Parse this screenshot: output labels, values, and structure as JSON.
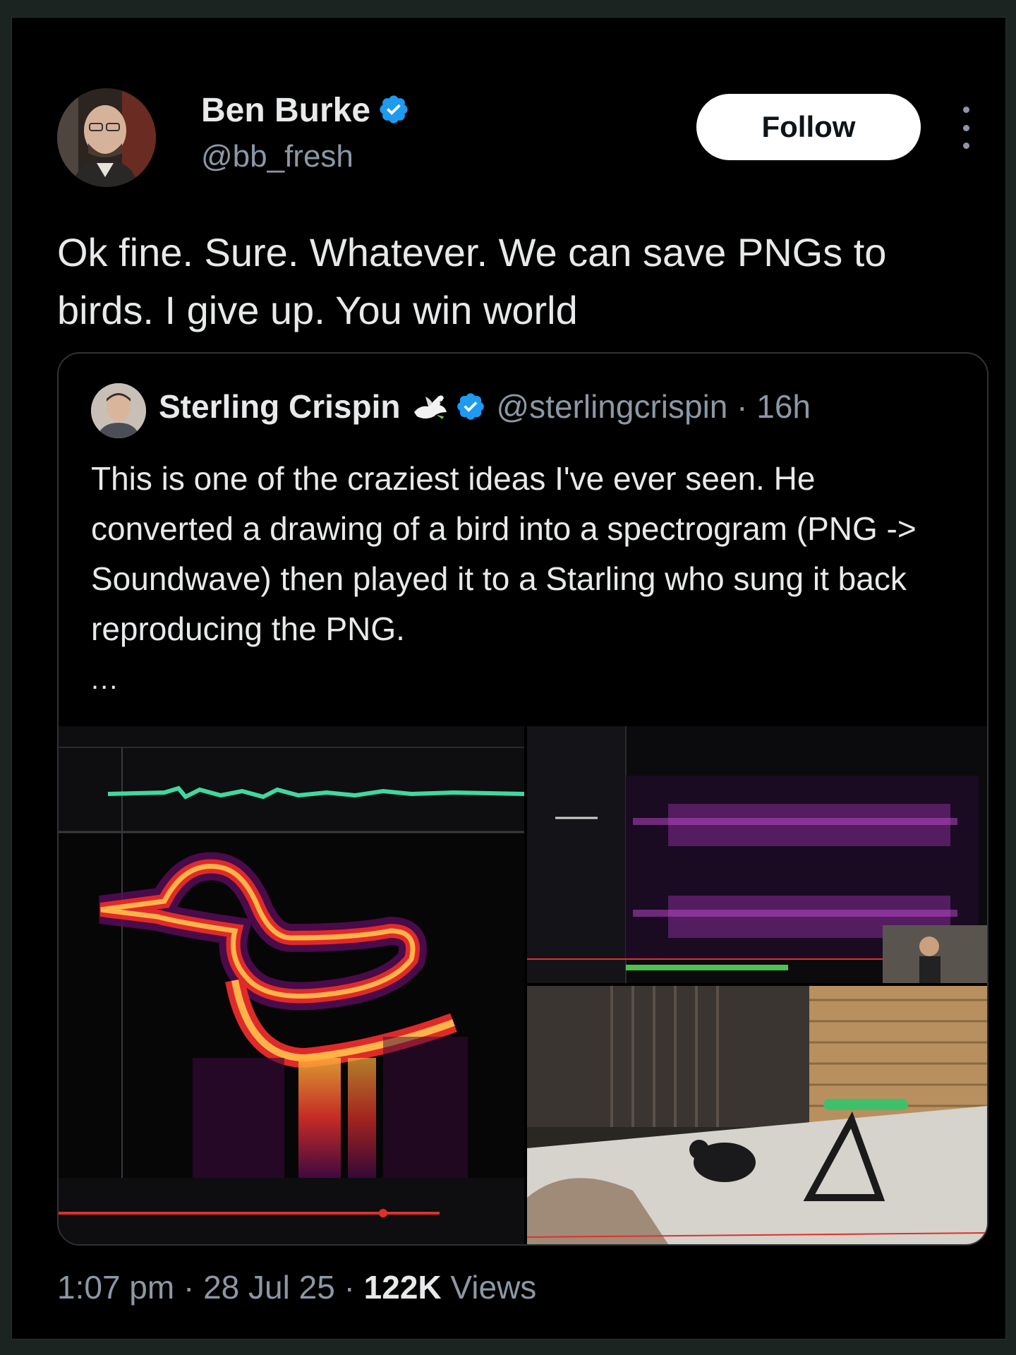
{
  "tweet": {
    "author": {
      "name": "Ben Burke",
      "handle": "@bb_fresh",
      "verified": true
    },
    "follow_label": "Follow",
    "text": "Ok fine. Sure. Whatever. We can save PNGs to birds. I give up. You win world",
    "timestamp": "1:07 pm · 28 Jul 25 · ",
    "views_count": "122K",
    "views_label": " Views"
  },
  "quote": {
    "name": "Sterling Crispin",
    "handle": "@sterlingcrispin · 16h",
    "verified": true,
    "text": "This is one of the craziest ideas I've ever seen. He converted a drawing of a bird into a spectrogram (PNG -> Soundwave) then played it to a Starling who sung it back reproducing the PNG.",
    "ellipsis": "...",
    "media": [
      "spectrogram-bird-drawing",
      "audio-editor-spectrogram-screen",
      "starling-on-perch-photo"
    ]
  },
  "colors": {
    "background": "#000000",
    "text": "#e7e9ea",
    "muted": "#8b98a5",
    "verified_blue": "#1d9bf0",
    "follow_bg": "#ffffff"
  },
  "icons": [
    "verified-badge-icon",
    "more-options-icon",
    "dove-emoji-icon"
  ]
}
